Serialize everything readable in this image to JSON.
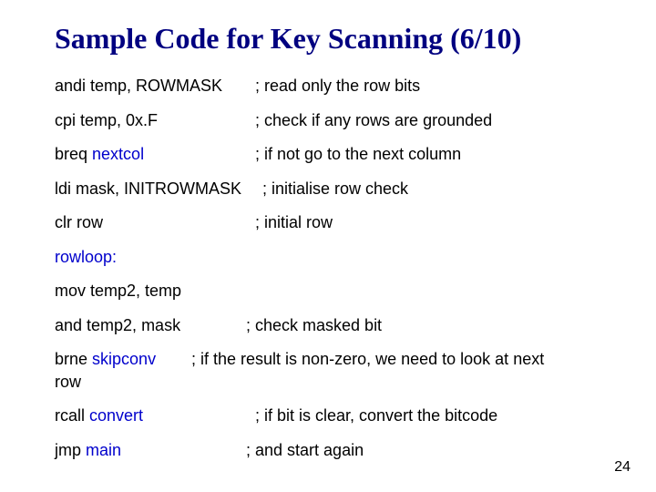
{
  "title": "Sample Code for Key Scanning (6/10)",
  "lines": {
    "l1": {
      "code_a": "andi temp, ROWMASK",
      "comment": "; read only the row bits"
    },
    "l2": {
      "code_a": "cpi temp, 0x.F",
      "comment": "; check if any rows are grounded"
    },
    "l3": {
      "code_a": "breq ",
      "code_b": "nextcol",
      "comment": "; if not go to the next column"
    },
    "l4": {
      "code_a": "ldi mask, INITROWMASK",
      "comment": "; initialise row check"
    },
    "l5": {
      "code_a": "clr row",
      "comment": "; initial row"
    },
    "l6": {
      "label": "rowloop:"
    },
    "l7": {
      "code_a": "mov temp2, temp"
    },
    "l8": {
      "code_a": "and temp2, mask",
      "comment": "; check masked bit"
    },
    "l9": {
      "code_a": "brne ",
      "code_b": "skipconv",
      "comment": "; if the result is non-zero, we need to look at next",
      "cont": "row"
    },
    "l10": {
      "code_a": "rcall ",
      "code_b": "convert",
      "comment": "; if bit is clear, convert the bitcode"
    },
    "l11": {
      "code_a": "jmp ",
      "code_b": "main",
      "comment": "; and start again"
    }
  },
  "pagenum": "24"
}
